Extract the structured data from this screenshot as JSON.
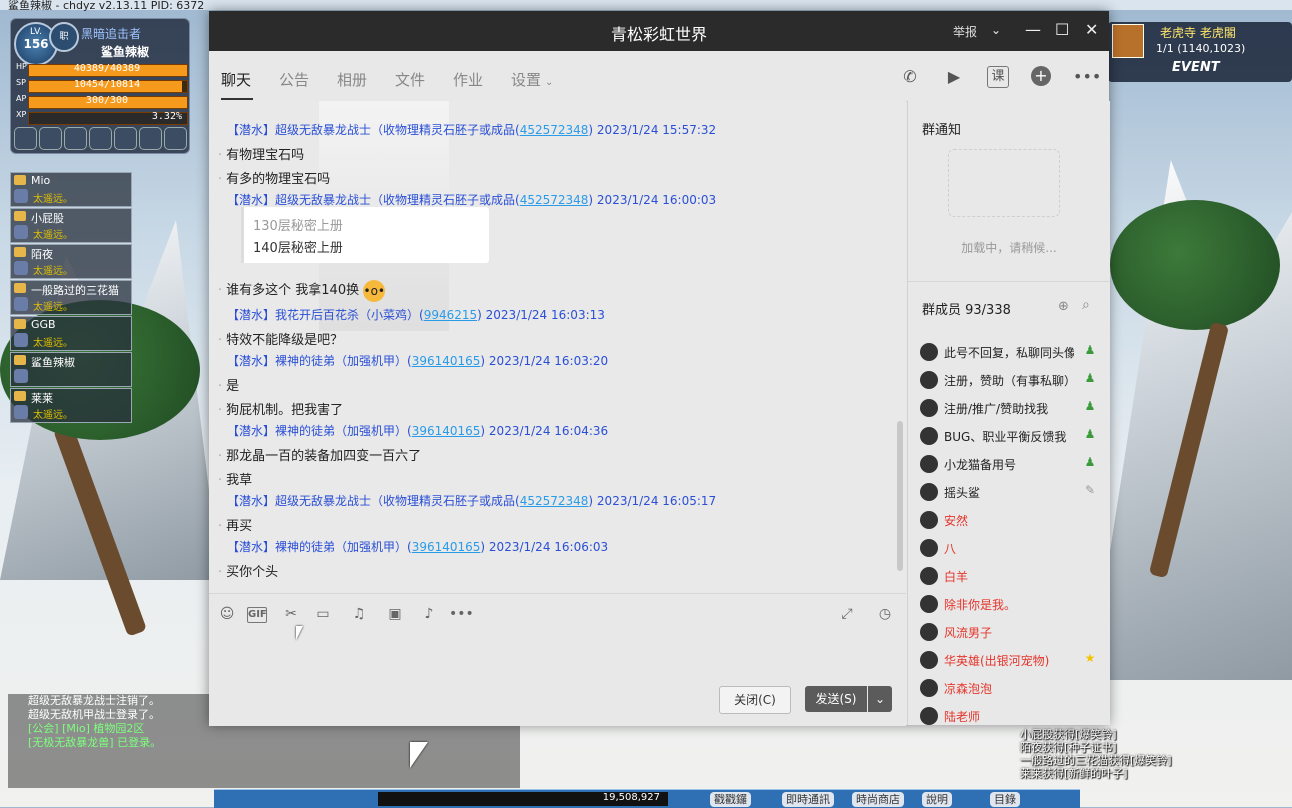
{
  "game": {
    "window_title": "鲨鱼辣椒 - chdyz v2.13.11    PID: 6372",
    "player": {
      "level_label": "LV.",
      "level": "156",
      "job_badge": "职",
      "title": "黑暗追击者",
      "name": "鲨鱼辣椒",
      "stats": [
        {
          "key": "HP",
          "value": "40389/40389",
          "fill": 1.0
        },
        {
          "key": "SP",
          "value": "10454/10814",
          "fill": 0.967
        },
        {
          "key": "AP",
          "value": "300/300",
          "fill": 1.0
        },
        {
          "key": "XP",
          "value": "3.32%",
          "fill": 0.0332
        }
      ]
    },
    "party": [
      {
        "name": "Mio",
        "status": "太遥远。"
      },
      {
        "name": "小屁股",
        "status": "太遥远。"
      },
      {
        "name": "陌夜",
        "status": "太遥远。"
      },
      {
        "name": "一般路过的三花猫",
        "status": "太遥远。"
      },
      {
        "name": "GGB",
        "status": "太遥远。"
      },
      {
        "name": "鲨鱼辣椒",
        "status": ""
      },
      {
        "name": "莱莱",
        "status": "太遥远。"
      }
    ],
    "map": {
      "name": "老虎寺 老虎閣",
      "coords": "1/1 (1140,1023)",
      "event": "EVENT"
    },
    "log": [
      "超级无敌暴龙战士注销了。",
      "超级无敌机甲战士登录了。",
      "[公会] [Mio] 植物园2区",
      "[无极无敌暴龙兽] 已登录。"
    ],
    "server_msgs": [
      "小屁股获得[爆笑铃]",
      "陌夜获得[种子证书]",
      "一般路过的三花猫获得[爆笑铃]",
      "莱莱获得[新鲜的叶子]"
    ],
    "taskbar": {
      "exp": "19,508,927",
      "buttons": [
        "戳戳鑼",
        "即時通訊",
        "時尚商店",
        "說明",
        "目錄"
      ]
    }
  },
  "qq": {
    "title": "青松彩虹世界",
    "report": "举报",
    "tabs": [
      "聊天",
      "公告",
      "相册",
      "文件",
      "作业",
      "设置"
    ],
    "top_icons": [
      "phone-icon",
      "video-icon",
      "course-icon",
      "add-icon",
      "more-icon"
    ],
    "course_label": "课",
    "messages": [
      {
        "type": "header",
        "role": "【潜水】",
        "name": "超级无敌暴龙战士（收物理精灵石胚子或成品(",
        "qq": "452572348",
        "time": ") 2023/1/24 15:57:32"
      },
      {
        "type": "text",
        "text": "有物理宝石吗"
      },
      {
        "type": "text",
        "text": "有多的物理宝石吗"
      },
      {
        "type": "header",
        "role": "【潜水】",
        "name": "超级无敌暴龙战士（收物理精灵石胚子或成品(",
        "qq": "452572348",
        "time": ") 2023/1/24 16:00:03"
      },
      {
        "type": "text",
        "text": "谁有多这个 我拿140换"
      },
      {
        "type": "header",
        "role": "【潜水】",
        "name": "我花开后百花杀（小菜鸡）(",
        "qq": "9946215",
        "time": ") 2023/1/24 16:03:13"
      },
      {
        "type": "text",
        "text": "特效不能降级是吧？"
      },
      {
        "type": "header",
        "role": "【潜水】",
        "name": "裸神的徒弟（加强机甲）(",
        "qq": "396140165",
        "time": ") 2023/1/24 16:03:20"
      },
      {
        "type": "text",
        "text": "是"
      },
      {
        "type": "text",
        "text": "狗屁机制。把我害了"
      },
      {
        "type": "header",
        "role": "【潜水】",
        "name": "裸神的徒弟（加强机甲）(",
        "qq": "396140165",
        "time": ") 2023/1/24 16:04:36"
      },
      {
        "type": "text",
        "text": "那龙晶一百的装备加四变一百六了"
      },
      {
        "type": "text",
        "text": "我草"
      },
      {
        "type": "header",
        "role": "【潜水】",
        "name": "超级无敌暴龙战士（收物理精灵石胚子或成品(",
        "qq": "452572348",
        "time": ") 2023/1/24 16:05:17"
      },
      {
        "type": "text",
        "text": "再买"
      },
      {
        "type": "header",
        "role": "【潜水】",
        "name": "裸神的徒弟（加强机甲）(",
        "qq": "396140165",
        "time": ") 2023/1/24 16:06:03"
      },
      {
        "type": "text",
        "text": "买你个头"
      }
    ],
    "image_lines": [
      "130层秘密上册",
      "140层秘密上册"
    ],
    "toolbar_icons": [
      "emoji-icon",
      "gif-icon",
      "scissors-icon",
      "folder-icon",
      "music-icon",
      "image-icon",
      "mute-icon",
      "more-icon"
    ],
    "gif_label": "GIF",
    "close_button": "关闭(C)",
    "send_button": "发送(S)",
    "notice": {
      "title": "群通知",
      "loading": "加载中，请稍候..."
    },
    "members": {
      "title": "群成员 93/338",
      "list": [
        {
          "name": "此号不回复，私聊同头像",
          "red": false,
          "mark": "admin"
        },
        {
          "name": "注册，赞助（有事私聊）",
          "red": false,
          "mark": "admin"
        },
        {
          "name": "注册/推广/赞助找我",
          "red": false,
          "mark": "admin"
        },
        {
          "name": "BUG、职业平衡反馈我",
          "red": false,
          "mark": "admin"
        },
        {
          "name": "小龙猫备用号",
          "red": false,
          "mark": "admin"
        },
        {
          "name": "摇头鲨",
          "red": false,
          "mark": "edit"
        },
        {
          "name": "安然",
          "red": true,
          "mark": ""
        },
        {
          "name": "八",
          "red": true,
          "mark": ""
        },
        {
          "name": "白羊",
          "red": true,
          "mark": ""
        },
        {
          "name": "除非你是我。",
          "red": true,
          "mark": ""
        },
        {
          "name": "风流男子",
          "red": true,
          "mark": ""
        },
        {
          "name": "华英雄(出银河宠物)",
          "red": true,
          "mark": "star"
        },
        {
          "name": "凉森泡泡",
          "red": true,
          "mark": ""
        },
        {
          "name": "陆老师",
          "red": true,
          "mark": ""
        }
      ]
    }
  }
}
